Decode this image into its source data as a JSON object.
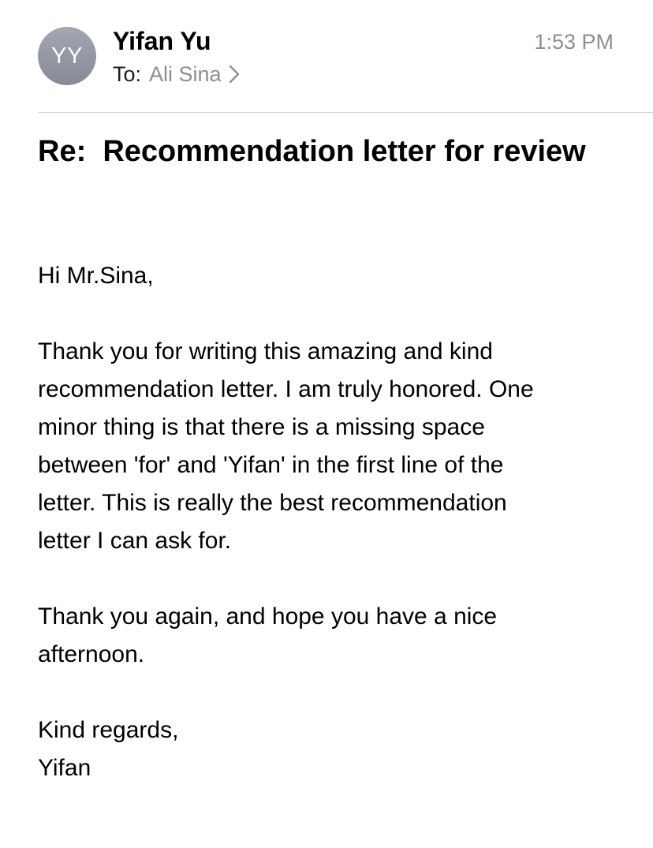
{
  "header": {
    "avatar_initials": "YY",
    "sender_name": "Yifan Yu",
    "to_label": "To:",
    "recipient_name": "Ali Sina",
    "time": "1:53 PM"
  },
  "subject": "Re:  Recommendation letter for review",
  "body": {
    "greeting": "Hi Mr.Sina,",
    "paragraph1": [
      "Thank you for writing this amazing and kind",
      "recommendation letter. I am truly honored. One",
      "minor thing is that there is a missing space",
      "between 'for' and 'Yifan' in the first line of the",
      "letter. This is really the best recommendation",
      "letter I can ask for."
    ],
    "paragraph2": [
      "Thank you again, and hope you have a nice",
      "afternoon."
    ],
    "closing": "Kind regards,",
    "signature": "Yifan"
  },
  "icons": {
    "recipient_chevron": "chevron-right-icon"
  },
  "colors": {
    "secondary_text": "#8e8e93",
    "avatar": "#959aa5",
    "divider": "#d1d1d6"
  }
}
